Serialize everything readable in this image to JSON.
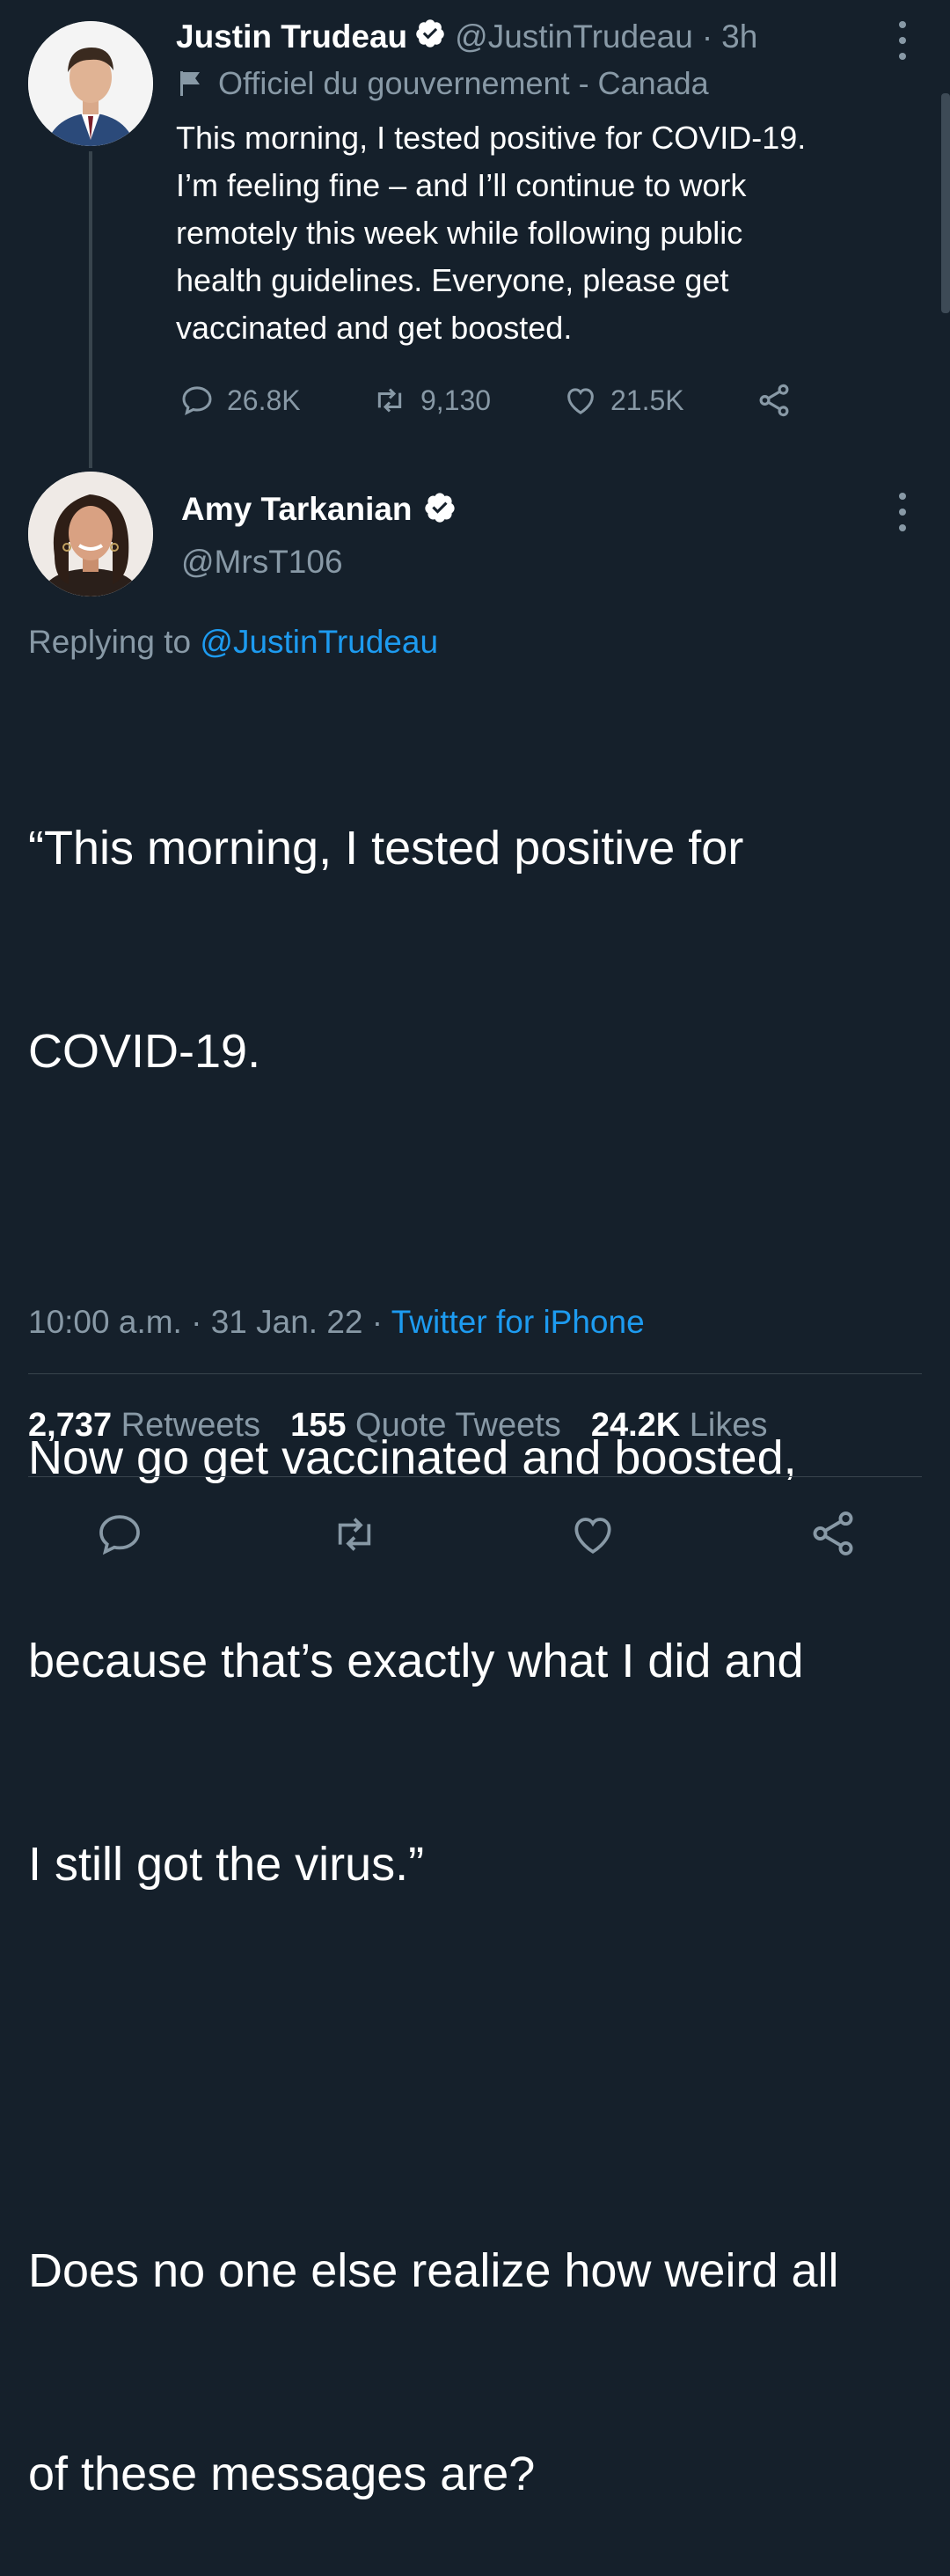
{
  "parent_tweet": {
    "author_name": "Justin Trudeau",
    "handle": "@JustinTrudeau",
    "separator": "·",
    "time": "3h",
    "label": "Officiel du gouvernement - Canada",
    "text_lines": [
      "This morning, I tested positive for COVID-19.",
      "I’m feeling fine – and I’ll continue to work",
      "remotely this week while following public",
      "health guidelines. Everyone, please get",
      "vaccinated and get boosted."
    ],
    "replies": "26.8K",
    "retweets": "9,130",
    "likes": "21.5K",
    "icons": {
      "reply": "reply-icon",
      "retweet": "retweet-icon",
      "like": "heart-icon",
      "share": "share-icon",
      "label": "flag-icon",
      "verified": "verified-badge-icon",
      "more": "more-options-icon"
    }
  },
  "main_tweet": {
    "author_name": "Amy Tarkanian",
    "handle": "@MrsT106",
    "replying_prefix": "Replying to",
    "replying_handle": "@JustinTrudeau",
    "text_lines": [
      "“This morning, I tested positive for",
      "COVID-19.",
      "",
      "Now go get vaccinated and boosted,",
      "because that’s exactly what I did and",
      "I still got the virus.”",
      "",
      "Does no one else realize how weird all",
      "of these messages are?"
    ],
    "timestamp": "10:00 a.m. · 31 Jan. 22 ·",
    "client": "Twitter for iPhone",
    "stats": {
      "retweets_count": "2,737",
      "retweets_label": "Retweets",
      "quotes_count": "155",
      "quotes_label": "Quote Tweets",
      "likes_count": "24.2K",
      "likes_label": "Likes"
    }
  },
  "colors": {
    "background": "#15202b",
    "text": "#ffffff",
    "muted": "#8899a6",
    "accent": "#1d9bf0",
    "divider": "#38444d"
  }
}
